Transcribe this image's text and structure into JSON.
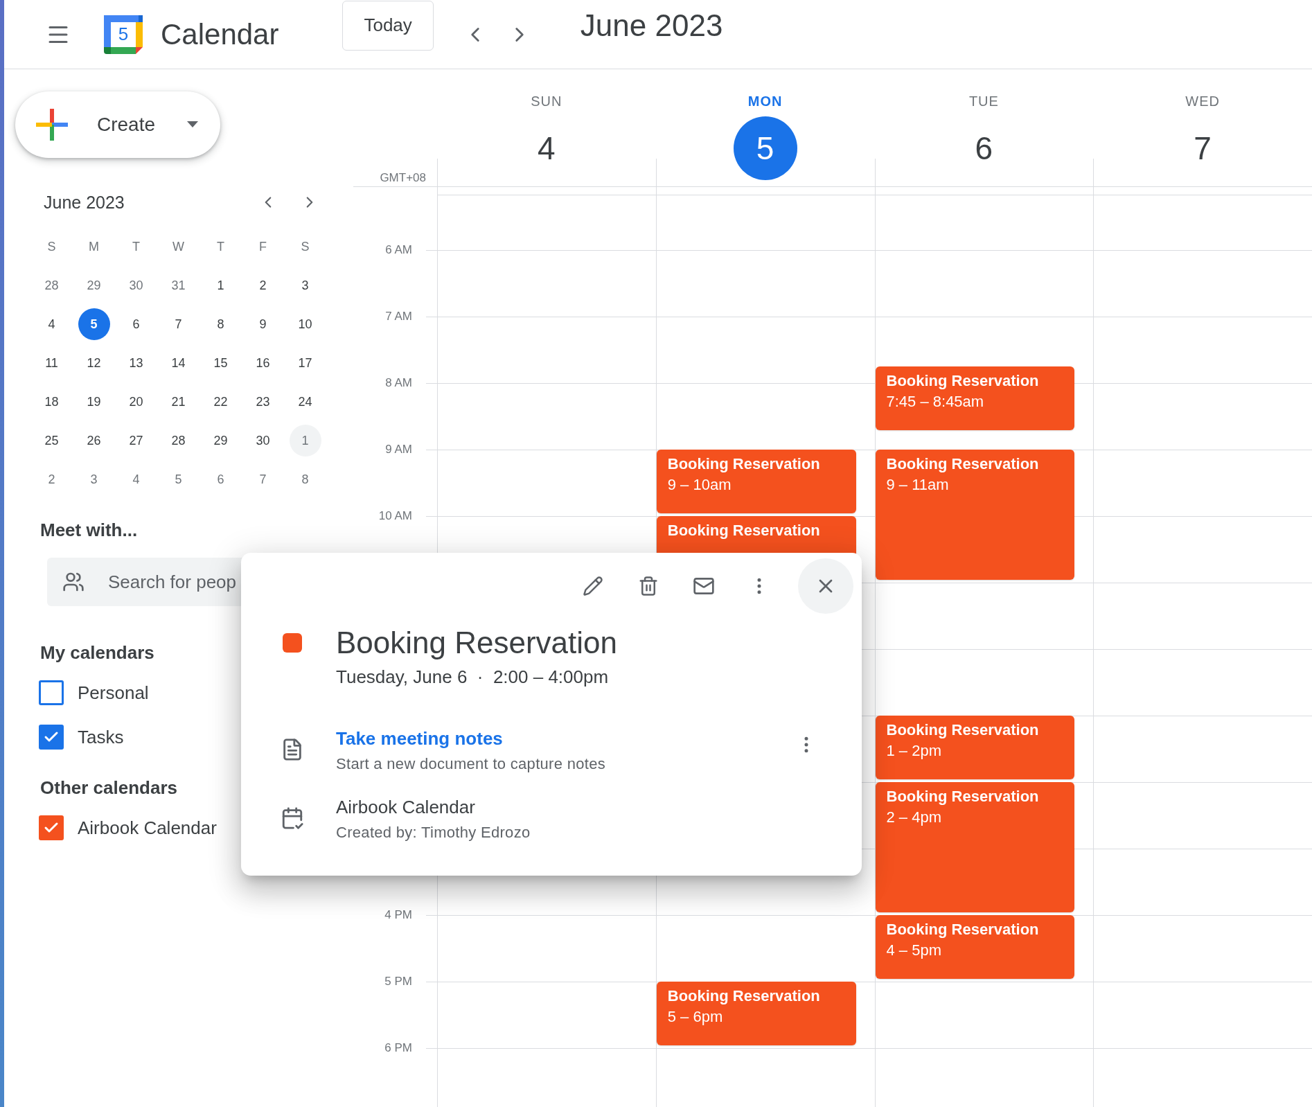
{
  "header": {
    "app_name": "Calendar",
    "logo_text": "5",
    "today_button": "Today",
    "period": "June 2023"
  },
  "sidebar": {
    "create_button": "Create",
    "mini_calendar": {
      "title": "June 2023",
      "weekdays": [
        "S",
        "M",
        "T",
        "W",
        "T",
        "F",
        "S"
      ],
      "weeks": [
        [
          {
            "label": "28",
            "muted": true,
            "selected": false,
            "highlighted": false
          },
          {
            "label": "29",
            "muted": true,
            "selected": false,
            "highlighted": false
          },
          {
            "label": "30",
            "muted": true,
            "selected": false,
            "highlighted": false
          },
          {
            "label": "31",
            "muted": true,
            "selected": false,
            "highlighted": false
          },
          {
            "label": "1",
            "muted": false,
            "selected": false,
            "highlighted": false
          },
          {
            "label": "2",
            "muted": false,
            "selected": false,
            "highlighted": false
          },
          {
            "label": "3",
            "muted": false,
            "selected": false,
            "highlighted": false
          }
        ],
        [
          {
            "label": "4",
            "muted": false,
            "selected": false,
            "highlighted": false
          },
          {
            "label": "5",
            "muted": false,
            "selected": true,
            "highlighted": false
          },
          {
            "label": "6",
            "muted": false,
            "selected": false,
            "highlighted": false
          },
          {
            "label": "7",
            "muted": false,
            "selected": false,
            "highlighted": false
          },
          {
            "label": "8",
            "muted": false,
            "selected": false,
            "highlighted": false
          },
          {
            "label": "9",
            "muted": false,
            "selected": false,
            "highlighted": false
          },
          {
            "label": "10",
            "muted": false,
            "selected": false,
            "highlighted": false
          }
        ],
        [
          {
            "label": "11",
            "muted": false,
            "selected": false,
            "highlighted": false
          },
          {
            "label": "12",
            "muted": false,
            "selected": false,
            "highlighted": false
          },
          {
            "label": "13",
            "muted": false,
            "selected": false,
            "highlighted": false
          },
          {
            "label": "14",
            "muted": false,
            "selected": false,
            "highlighted": false
          },
          {
            "label": "15",
            "muted": false,
            "selected": false,
            "highlighted": false
          },
          {
            "label": "16",
            "muted": false,
            "selected": false,
            "highlighted": false
          },
          {
            "label": "17",
            "muted": false,
            "selected": false,
            "highlighted": false
          }
        ],
        [
          {
            "label": "18",
            "muted": false,
            "selected": false,
            "highlighted": false
          },
          {
            "label": "19",
            "muted": false,
            "selected": false,
            "highlighted": false
          },
          {
            "label": "20",
            "muted": false,
            "selected": false,
            "highlighted": false
          },
          {
            "label": "21",
            "muted": false,
            "selected": false,
            "highlighted": false
          },
          {
            "label": "22",
            "muted": false,
            "selected": false,
            "highlighted": false
          },
          {
            "label": "23",
            "muted": false,
            "selected": false,
            "highlighted": false
          },
          {
            "label": "24",
            "muted": false,
            "selected": false,
            "highlighted": false
          }
        ],
        [
          {
            "label": "25",
            "muted": false,
            "selected": false,
            "highlighted": false
          },
          {
            "label": "26",
            "muted": false,
            "selected": false,
            "highlighted": false
          },
          {
            "label": "27",
            "muted": false,
            "selected": false,
            "highlighted": false
          },
          {
            "label": "28",
            "muted": false,
            "selected": false,
            "highlighted": false
          },
          {
            "label": "29",
            "muted": false,
            "selected": false,
            "highlighted": false
          },
          {
            "label": "30",
            "muted": false,
            "selected": false,
            "highlighted": false
          },
          {
            "label": "1",
            "muted": true,
            "selected": false,
            "highlighted": true
          }
        ],
        [
          {
            "label": "2",
            "muted": true,
            "selected": false,
            "highlighted": false
          },
          {
            "label": "3",
            "muted": true,
            "selected": false,
            "highlighted": false
          },
          {
            "label": "4",
            "muted": true,
            "selected": false,
            "highlighted": false
          },
          {
            "label": "5",
            "muted": true,
            "selected": false,
            "highlighted": false
          },
          {
            "label": "6",
            "muted": true,
            "selected": false,
            "highlighted": false
          },
          {
            "label": "7",
            "muted": true,
            "selected": false,
            "highlighted": false
          },
          {
            "label": "8",
            "muted": true,
            "selected": false,
            "highlighted": false
          }
        ]
      ]
    },
    "meet_with": {
      "heading": "Meet with...",
      "placeholder": "Search for peop"
    },
    "calendar_groups": [
      {
        "heading": "My calendars",
        "items": [
          {
            "label": "Personal",
            "checked": false,
            "color": "#1a73e8"
          },
          {
            "label": "Tasks",
            "checked": true,
            "color": "#1a73e8"
          }
        ]
      },
      {
        "heading": "Other calendars",
        "items": [
          {
            "label": "Airbook Calendar",
            "checked": true,
            "color": "#f4511e"
          }
        ]
      }
    ]
  },
  "week": {
    "timezone": "GMT+08",
    "time_labels": [
      "6 AM",
      "7 AM",
      "8 AM",
      "9 AM",
      "10 AM",
      "4 PM",
      "5 PM",
      "6 PM"
    ],
    "days": [
      {
        "weekday": "SUN",
        "date": "4",
        "today": false
      },
      {
        "weekday": "MON",
        "date": "5",
        "today": true,
        "events": [
          {
            "title": "Booking Reservation",
            "time": "9 – 10am"
          },
          {
            "title": "Booking Reservation"
          },
          {
            "title": "Booking Reservation",
            "time": "5 – 6pm"
          }
        ]
      },
      {
        "weekday": "TUE",
        "date": "6",
        "today": false,
        "events": [
          {
            "title": "Booking Reservation",
            "time": "7:45 – 8:45am"
          },
          {
            "title": "Booking Reservation",
            "time": "9 – 11am"
          },
          {
            "title": "Booking Reservation",
            "time": "1 – 2pm"
          },
          {
            "title": "Booking Reservation",
            "time": "2 – 4pm"
          },
          {
            "title": "Booking Reservation",
            "time": "4 – 5pm"
          }
        ]
      },
      {
        "weekday": "WED",
        "date": "7",
        "today": false
      }
    ]
  },
  "event_popup": {
    "title": "Booking Reservation",
    "color": "#f4511e",
    "when": "Tuesday, June 6  ·  2:00 – 4:00pm",
    "notes_link": "Take meeting notes",
    "notes_hint": "Start a new document to capture notes",
    "calendar": "Airbook Calendar",
    "creator": "Created by: Timothy Edrozo"
  }
}
